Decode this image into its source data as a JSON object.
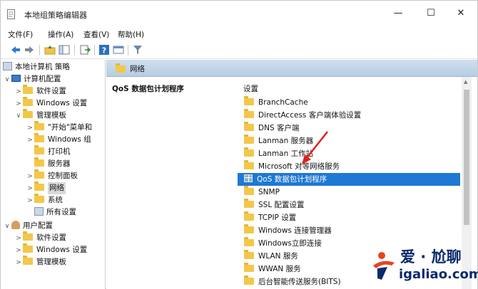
{
  "window": {
    "title": "本地组策略编辑器",
    "minimize": "—",
    "maximize": "☐",
    "close": "✕"
  },
  "menu": [
    "文件(F)",
    "操作(A)",
    "查看(V)",
    "帮助(H)"
  ],
  "tree": {
    "root": "本地计算机 策略",
    "computer_config": "计算机配置",
    "software_settings": "软件设置",
    "windows_settings": "Windows 设置",
    "admin_templates": "管理模板",
    "start_menu": "\"开始\"菜单和",
    "windows_components": "Windows 组",
    "printers": "打印机",
    "servers": "服务器",
    "control_panel": "控制面板",
    "network": "网络",
    "system": "系统",
    "all_settings": "所有设置",
    "user_config": "用户配置",
    "user_software_settings": "软件设置",
    "user_windows_settings": "Windows 设置",
    "user_admin_templates": "管理模板"
  },
  "content": {
    "header_title": "网络",
    "description_title": "QoS 数据包计划程序",
    "list_header": "设置",
    "items": [
      "BranchCache",
      "DirectAccess 客户端体验设置",
      "DNS 客户端",
      "Lanman 服务器",
      "Lanman 工作站",
      "Microsoft 对等网络服务",
      "QoS 数据包计划程序",
      "SNMP",
      "SSL 配置设置",
      "TCPIP 设置",
      "Windows 连接管理器",
      "Windows立即连接",
      "WLAN 服务",
      "WWAN 服务",
      "后台智能传送服务(BITS)"
    ],
    "selected_index": 6
  },
  "watermark": {
    "line1": "爱 · 尬聊",
    "line2": "igaliao.com"
  },
  "colors": {
    "selection": "#1e78d4",
    "header_band": "#c4d7ea",
    "arrow": "#e0201c",
    "watermark": "#0b2a6b",
    "watermark_accent": "#e8431a"
  }
}
